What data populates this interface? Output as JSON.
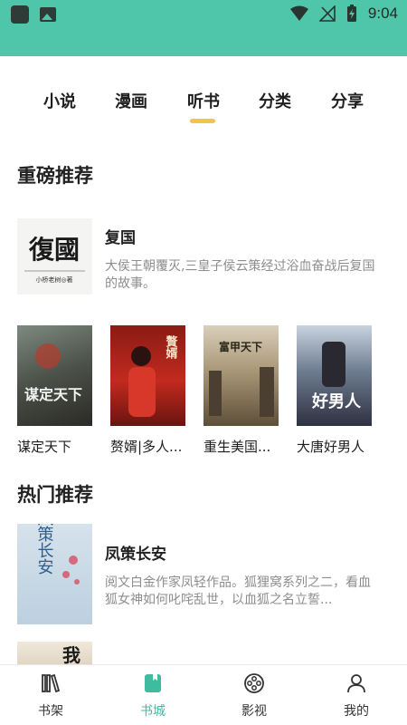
{
  "status_bar": {
    "time": "9:04"
  },
  "tabs": [
    {
      "label": "小说",
      "active": false
    },
    {
      "label": "漫画",
      "active": false
    },
    {
      "label": "听书",
      "active": true
    },
    {
      "label": "分类",
      "active": false
    },
    {
      "label": "分享",
      "active": false
    }
  ],
  "featured": {
    "section_title": "重磅推荐",
    "top_book": {
      "title": "复国",
      "description": "大侯王朝覆灭,三皇子侯云策经过浴血奋战后复国的故事。",
      "cover_title": "復國",
      "cover_author": "小桥老树◎著"
    },
    "grid": [
      {
        "title": "谋定天下",
        "cover_text": "谋定天下"
      },
      {
        "title": "赘婿|多人...",
        "cover_text": "贅婿"
      },
      {
        "title": "重生美国...",
        "cover_text": "富甲天下"
      },
      {
        "title": "大唐好男人",
        "cover_text": "好男人"
      }
    ]
  },
  "hot": {
    "section_title": "热门推荐",
    "books": [
      {
        "title": "凤策长安",
        "description": "阅文白金作家凤轻作品。狐狸窝系列之二，看血狐女神如何叱咤乱世，以血狐之名立誓...",
        "cover_text": "凤策长安"
      },
      {
        "title": "",
        "description": "",
        "cover_text": "我"
      }
    ]
  },
  "bottom_nav": [
    {
      "label": "书架",
      "icon": "bookshelf-icon",
      "active": false
    },
    {
      "label": "书城",
      "icon": "bookstore-icon",
      "active": true
    },
    {
      "label": "影视",
      "icon": "film-reel-icon",
      "active": false
    },
    {
      "label": "我的",
      "icon": "profile-icon",
      "active": false
    }
  ],
  "colors": {
    "status_bar": "#4fc6a9",
    "accent": "#3fbba0",
    "tab_indicator": "#f5c34a"
  }
}
